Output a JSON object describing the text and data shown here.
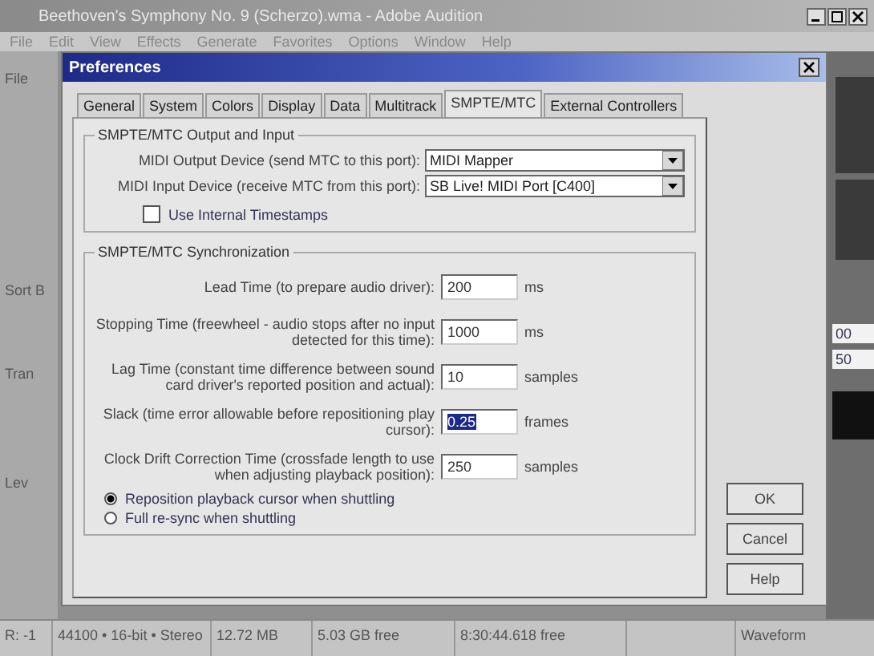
{
  "app": {
    "title": "Beethoven's Symphony No. 9 (Scherzo).wma - Adobe Audition",
    "menu": [
      "File",
      "Edit",
      "View",
      "Effects",
      "Generate",
      "Favorites",
      "Options",
      "Window",
      "Help"
    ],
    "side_labels": [
      "File",
      "Sort B",
      "Tran",
      "Lev"
    ],
    "right_fields": [
      "00",
      "50"
    ],
    "status_bar": [
      "R: -1",
      "44100 • 16-bit • Stereo",
      "12.72 MB",
      "5.03 GB free",
      "8:30:44.618 free",
      "Waveform"
    ]
  },
  "dialog": {
    "title": "Preferences",
    "tabs": [
      {
        "label": "General",
        "selected": false
      },
      {
        "label": "System",
        "selected": false
      },
      {
        "label": "Colors",
        "selected": false
      },
      {
        "label": "Display",
        "selected": false
      },
      {
        "label": "Data",
        "selected": false
      },
      {
        "label": "Multitrack",
        "selected": false
      },
      {
        "label": "SMPTE/MTC",
        "selected": true
      },
      {
        "label": "External Controllers",
        "selected": false
      }
    ],
    "groups": [
      {
        "title": "SMPTE/MTC Output and Input",
        "rows": [
          {
            "kind": "select",
            "label": "MIDI Output Device (send MTC to this port):",
            "value": "MIDI Mapper"
          },
          {
            "kind": "select",
            "label": "MIDI Input Device (receive MTC from this port):",
            "value": "SB Live! MIDI Port [C400]"
          },
          {
            "kind": "checkbox",
            "label": "Use Internal Timestamps",
            "checked": false
          }
        ]
      },
      {
        "title": "SMPTE/MTC Synchronization",
        "rows": [
          {
            "kind": "field",
            "label": "Lead Time (to prepare audio driver):",
            "value": "200",
            "unit": "ms",
            "highlighted": false
          },
          {
            "kind": "field",
            "label": "Stopping Time (freewheel - audio stops after no input detected for this time):",
            "value": "1000",
            "unit": "ms",
            "highlighted": false
          },
          {
            "kind": "field",
            "label": "Lag Time (constant time difference between sound card driver's reported position and actual):",
            "value": "10",
            "unit": "samples",
            "highlighted": false
          },
          {
            "kind": "field",
            "label": "Slack (time error allowable before repositioning play cursor):",
            "value": "0.25",
            "unit": "frames",
            "highlighted": true
          },
          {
            "kind": "field",
            "label": "Clock Drift Correction Time (crossfade length to use when adjusting playback position):",
            "value": "250",
            "unit": "samples",
            "highlighted": false
          },
          {
            "kind": "radio",
            "label": "Reposition playback cursor when shuttling",
            "selected": true
          },
          {
            "kind": "radio",
            "label": "Full re-sync when shuttling",
            "selected": false
          }
        ]
      }
    ],
    "buttons": [
      "OK",
      "Cancel",
      "Help"
    ]
  }
}
